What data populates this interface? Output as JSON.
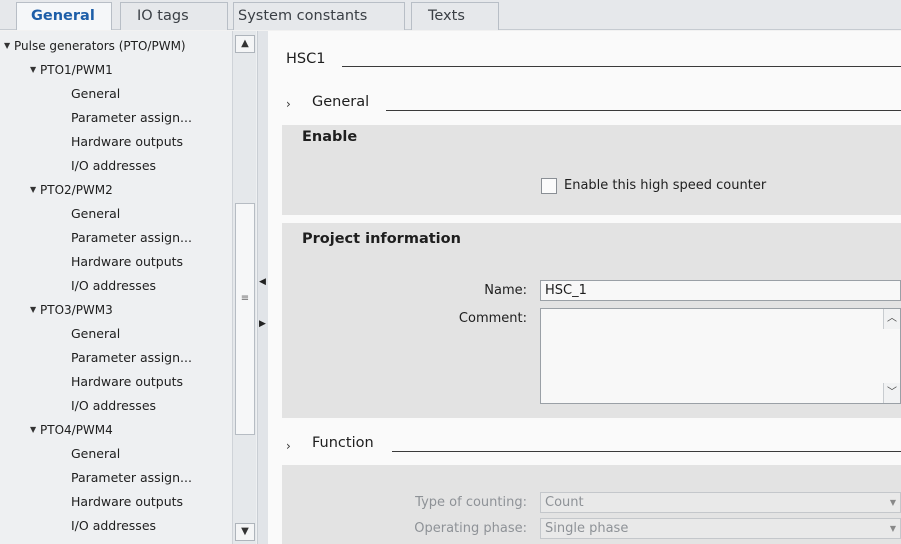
{
  "tabs": [
    {
      "label": "General",
      "active": true
    },
    {
      "label": "IO tags",
      "active": false
    },
    {
      "label": "System constants",
      "active": false
    },
    {
      "label": "Texts",
      "active": false
    }
  ],
  "tree": {
    "root": "Pulse generators (PTO/PWM)",
    "groups": [
      {
        "label": "PTO1/PWM1",
        "items": [
          "General",
          "Parameter assign...",
          "Hardware outputs",
          "I/O addresses"
        ]
      },
      {
        "label": "PTO2/PWM2",
        "items": [
          "General",
          "Parameter assign...",
          "Hardware outputs",
          "I/O addresses"
        ]
      },
      {
        "label": "PTO3/PWM3",
        "items": [
          "General",
          "Parameter assign...",
          "Hardware outputs",
          "I/O addresses"
        ]
      },
      {
        "label": "PTO4/PWM4",
        "items": [
          "General",
          "Parameter assign...",
          "Hardware outputs",
          "I/O addresses"
        ]
      }
    ],
    "expand_icon": "triangle-down-icon",
    "scroll_up_icon": "chevron-up-icon",
    "scroll_down_icon": "chevron-down-icon"
  },
  "main": {
    "title": "HSC1",
    "general_section": "General",
    "enable": {
      "heading": "Enable",
      "checkbox_label": "Enable this high speed counter",
      "checked": false
    },
    "project_info": {
      "heading": "Project information",
      "name_label": "Name:",
      "name_value": "HSC_1",
      "comment_label": "Comment:",
      "comment_value": ""
    },
    "function_section": "Function",
    "function": {
      "type_label": "Type of counting:",
      "type_value": "Count",
      "phase_label": "Operating phase:",
      "phase_value": "Single phase"
    }
  },
  "colors": {
    "accent": "#1d5ea8",
    "panel_band": "#e3e3e3",
    "tree_bg": "#eef0f2"
  }
}
